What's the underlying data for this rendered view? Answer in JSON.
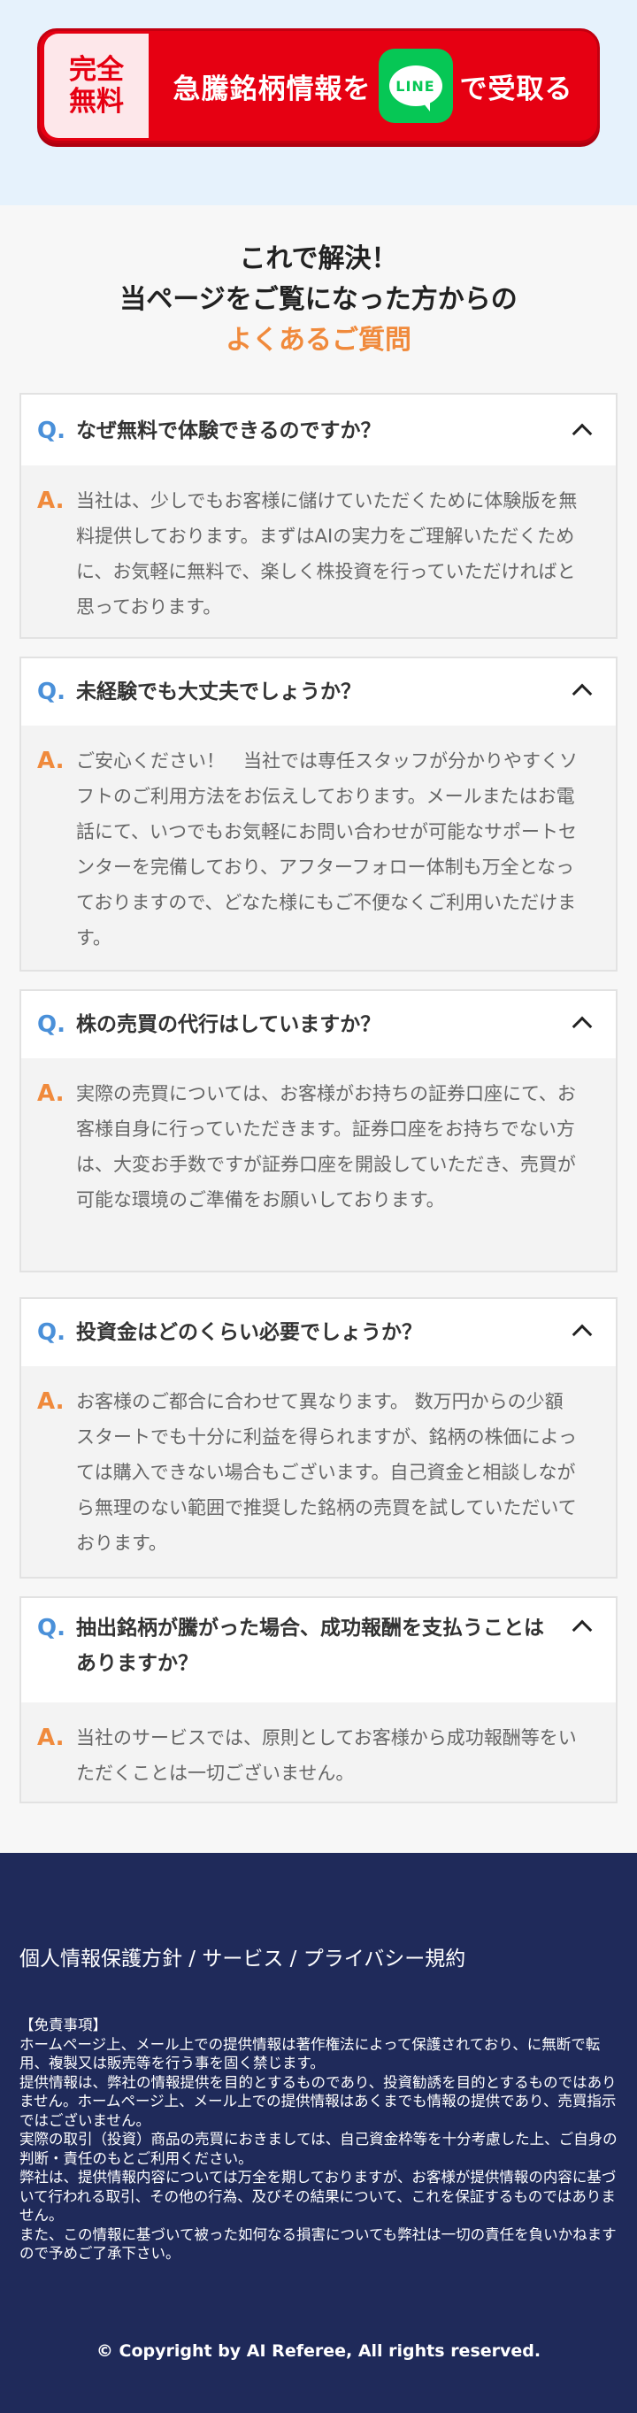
{
  "banner": {
    "free_line1": "完全",
    "free_line2": "無料",
    "cta_before": "急騰銘柄情報を",
    "line_logo": "LINE",
    "cta_after": "で受取る"
  },
  "faq_heading": {
    "line1": "これで解決！",
    "line2": "当ページをご覧になった方からの",
    "line3": "よくあるご質問"
  },
  "faqs": [
    {
      "q": "なぜ無料で体験できるのですか？",
      "a": "当社は、少しでもお客様に儲けていただくために体験版を無料提供しております。まずはAIの実力をご理解いただくために、お気軽に無料で、楽しく株投資を行っていただければと思っております。"
    },
    {
      "q": "未経験でも大丈夫でしょうか？",
      "a": "ご安心ください！　当社では専任スタッフが分かりやすくソフトのご利用方法をお伝えしております。メールまたはお電話にて、いつでもお気軽にお問い合わせが可能なサポートセンターを完備しており、アフターフォロー体制も万全となっておりますので、どなた様にもご不便なくご利用いただけます。"
    },
    {
      "q": "株の売買の代行はしていますか？",
      "a": "実際の売買については、お客様がお持ちの証券口座にて、お客様自身に行っていただきます。証券口座をお持ちでない方は、大変お手数ですが証券口座を開設していただき、売買が可能な環境のご準備をお願いしております。"
    },
    {
      "q": "投資金はどのくらい必要でしょうか？",
      "a": "お客様のご都合に合わせて異なります。 数万円からの少額スタートでも十分に利益を得られますが、銘柄の株価によっては購入できない場合もございます。自己資金と相談しながら無理のない範囲で推奨した銘柄の売買を試していただいております。"
    },
    {
      "q": "抽出銘柄が騰がった場合、成功報酬を支払うことはありますか？",
      "a": "当社のサービスでは、原則としてお客様から成功報酬等をいただくことは一切ございません。"
    }
  ],
  "qa_marks": {
    "q": "Q.",
    "a": "A."
  },
  "footer": {
    "policy_links": "個人情報保護方針 / サービス / プライバシー規約",
    "disclaimer_title": "【免責事項】",
    "disclaimer_1": "ホームページ上、メール上での提供情報は著作権法によって保護されており、に無断で転用、複製又は販売等を行う事を固く禁じます。",
    "disclaimer_2": "提供情報は、弊社の情報提供を目的とするものであり、投資勧誘を目的とするものではありません。ホームページ上、メール上での提供情報はあくまでも情報の提供であり、売買指示ではございません。",
    "disclaimer_3": "実際の取引（投資）商品の売買におきましては、自己資金枠等を十分考慮した上、ご自身の判断・責任のもとご利用ください。",
    "disclaimer_4": "弊社は、提供情報内容については万全を期しておりますが、お客様が提供情報の内容に基づいて行われる取引、その他の行為、及びその結果について、これを保証するものではありません。",
    "disclaimer_5": "また、この情報に基づいて被った如何なる損害についても弊社は一切の責任を負いかねますので予めご了承下さい。",
    "copyright": "© Copyright by AI Referee, All rights reserved."
  },
  "colors": {
    "cta_red": "#e60012",
    "line_green": "#06c755",
    "q_blue": "#4a90d9",
    "a_orange": "#f08a3c",
    "footer_navy": "#1f2a5a"
  }
}
